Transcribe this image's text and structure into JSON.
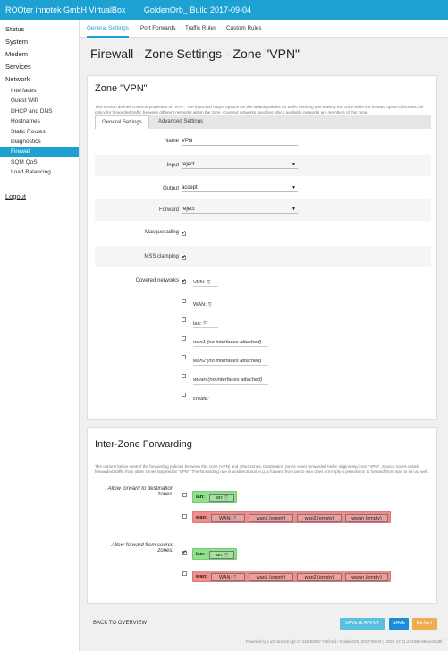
{
  "header": {
    "title": "ROOter innotek GmbH VirtualBox",
    "subtitle": "GoldenOrb_ Build 2017-09-04"
  },
  "sidebar": {
    "main": [
      {
        "label": "Status"
      },
      {
        "label": "System"
      },
      {
        "label": "Modem"
      },
      {
        "label": "Services"
      },
      {
        "label": "Network"
      }
    ],
    "network_items": [
      "Interfaces",
      "Guest Wifi",
      "DHCP and DNS",
      "Hostnames",
      "Static Routes",
      "Diagnostics",
      "Firewall",
      "SQM QoS",
      "Load Balancing"
    ],
    "logout": "Logout"
  },
  "tabs": [
    "General Settings",
    "Port Forwards",
    "Traffic Rules",
    "Custom Rules"
  ],
  "page_title": "Firewall - Zone Settings - Zone \"VPN\"",
  "zone_panel": {
    "heading": "Zone \"VPN\"",
    "description": "This section defines common properties of \"VPN\". The input and output options set the default policies for traffic entering and leaving this zone while the forward option describes the policy for forwarded traffic between different networks within the zone. Covered networks specifies which available networks are members of this zone.",
    "subtabs": [
      "General Settings",
      "Advanced Settings"
    ],
    "name_label": "Name",
    "name_value": "VPN",
    "input_label": "Input",
    "input_value": "reject",
    "output_label": "Output",
    "output_value": "accept",
    "forward_label": "Forward",
    "forward_value": "reject",
    "masq_label": "Masquerading",
    "mss_label": "MSS clamping",
    "covered_label": "Covered networks",
    "networks": [
      "VPN:",
      "WAN:",
      "lan:",
      "wan1 (no interfaces attached)",
      "wan2 (no interfaces attached)",
      "wwan (no interfaces attached)",
      "create:"
    ]
  },
  "inter_zone": {
    "heading": "Inter-Zone Forwarding",
    "description": "The options below control the forwarding policies between this zone (VPN) and other zones. Destination zones cover forwarded traffic originating from \"VPN\". Source zones match forwarded traffic from other zones targeted at \"VPN\". The forwarding rule is unidirectional, e.g. a forward from lan to wan does not imply a permission to forward from wan to lan as well.",
    "dest_label": "Allow forward to destination zones:",
    "src_label": "Allow forward from source zones:",
    "lan_zone": {
      "label": "lan:",
      "chips": [
        "lan:"
      ]
    },
    "wan_zone": {
      "label": "wan:",
      "chips": [
        "WAN:",
        "wan1 (empty)",
        "wan2 (empty)",
        "wwan (empty)"
      ]
    }
  },
  "footer_actions": {
    "back": "BACK TO OVERVIEW",
    "save_apply": "SAVE & APPLY",
    "save": "SAVE",
    "reset": "RESET"
  },
  "footer_text": "Powered by LuCI branch (git-17.152.82987-7f6fc16) / GoldenOrb_2017-09-04 ( LEDE 17.01.2 r3435-65eec8bd5f )",
  "colors": {
    "brand": "#1da1d3",
    "save_apply": "#5bc0de",
    "save": "#1a8cd8",
    "reset": "#f0ad4e",
    "zone_green": "#90e090",
    "zone_red": "#f08c8c"
  }
}
